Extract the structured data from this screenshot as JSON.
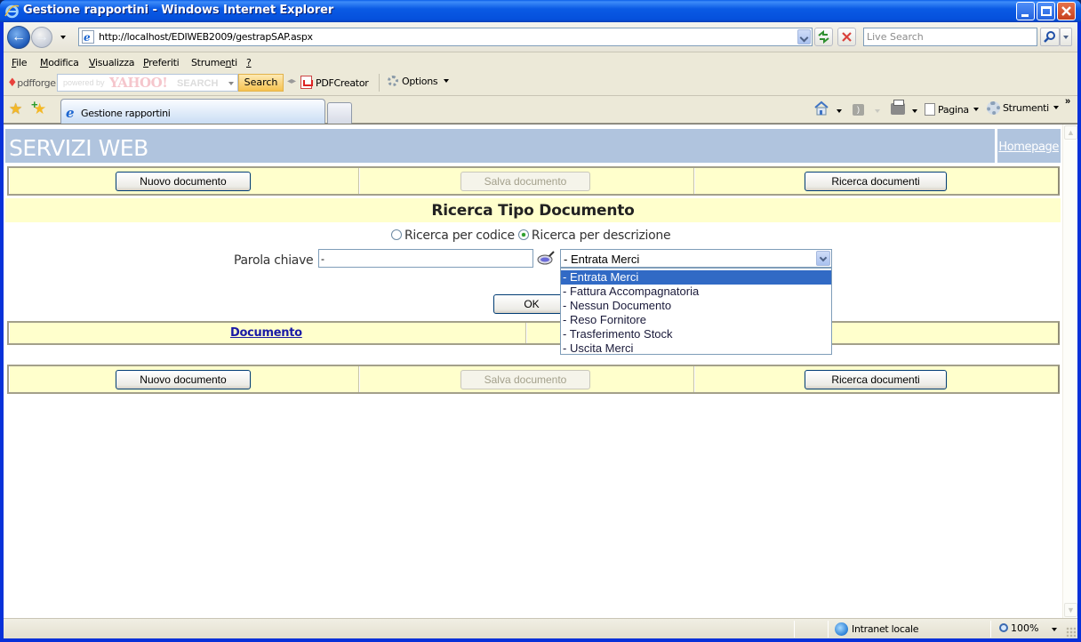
{
  "window": {
    "title": "Gestione rapportini - Windows Internet Explorer",
    "controls": [
      "minimize",
      "maximize",
      "close"
    ]
  },
  "address_bar": {
    "url": "http://localhost/EDIWEB2009/gestrapSAP.aspx",
    "search_placeholder": "Live Search"
  },
  "menu": {
    "items": [
      {
        "label": "File",
        "accel": "F"
      },
      {
        "label": "Modifica",
        "accel": "M"
      },
      {
        "label": "Visualizza",
        "accel": "V"
      },
      {
        "label": "Preferiti",
        "accel": "P"
      },
      {
        "label": "Strumenti",
        "accel": "n"
      },
      {
        "label": "?",
        "accel": "?"
      }
    ]
  },
  "toolbar": {
    "pdfforge_label": "pdfforge",
    "yahoo_powered": "powered by",
    "yahoo_brand": "YAHOO!",
    "yahoo_search_word": "SEARCH",
    "search_button": "Search",
    "pdfcreator_label": "PDFCreator",
    "options_label": "Options"
  },
  "tabs": {
    "active_tab_label": "Gestione rapportini"
  },
  "command_bar": {
    "page_label": "Pagina",
    "tools_label": "Strumenti",
    "more": "»"
  },
  "page": {
    "brand": "SERVIZI WEB",
    "homepage_link": "Homepage",
    "top_buttons": {
      "new": "Nuovo documento",
      "save": "Salva documento",
      "search": "Ricerca documenti"
    },
    "section_title": "Ricerca Tipo Documento",
    "search_modes": [
      {
        "label": "Ricerca per codice",
        "checked": false
      },
      {
        "label": "Ricerca per descrizione",
        "checked": true
      }
    ],
    "keyword_label": "Parola chiave",
    "keyword_value": "-",
    "doc_type_select": {
      "selected": "- Entrata Merci",
      "options": [
        "- Entrata Merci",
        "- Fattura Accompagnatoria",
        "- Nessun Documento",
        "- Reso Fornitore",
        "- Trasferimento Stock",
        "- Uscita Merci"
      ],
      "highlighted_index": 0
    },
    "ok_button": "OK",
    "results_header": {
      "document_column": "Documento"
    },
    "bottom_buttons": {
      "new": "Nuovo documento",
      "save": "Salva documento",
      "search": "Ricerca documenti"
    }
  },
  "status_bar": {
    "zone": "Intranet locale",
    "zoom": "100%"
  },
  "colors": {
    "header_band": "#b0c4de",
    "row_band": "#ffffcc",
    "selection": "#316ac5",
    "link": "#1a1aa6"
  }
}
